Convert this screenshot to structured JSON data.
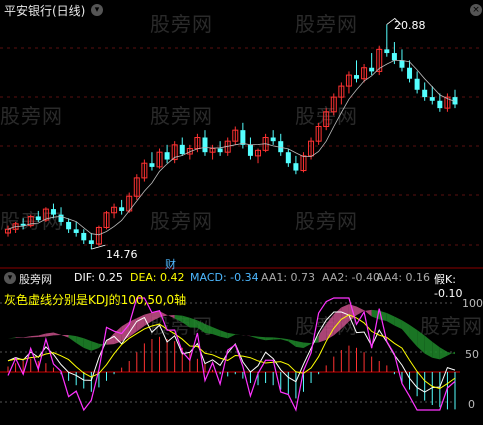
{
  "header": {
    "title": "平安银行(日线)",
    "watermark": "股旁网"
  },
  "price_chart": {
    "high_label": "20.88",
    "low_label": "14.76",
    "event_label": "财",
    "corner_icon": "close-icon"
  },
  "indicator_bar": {
    "name": "股旁网",
    "dif": "DIF: 0.25",
    "dea": "DEA: 0.42",
    "macd": "MACD: -0.34",
    "aa1": "AA1: 0.73",
    "aa2": "AA2: -0.40",
    "aa4": "AA4: 0.16",
    "jk": "假K: -0.10",
    "note": "灰色虚线分别是KDJ的100,50,0轴",
    "axis_ticks": [
      "100",
      "50",
      "0"
    ]
  },
  "colors": {
    "up": "#ff3232",
    "down": "#54ffff",
    "ma": "#ffffff",
    "dif": "#ffffff",
    "dea": "#ffff00",
    "kdj": "#ff33ff",
    "fill_pink": "#c8508a",
    "fill_green": "#1f8a2a"
  },
  "chart_data": [
    {
      "type": "candlestick",
      "title": "平安银行(日线)",
      "annotations": [
        "20.88",
        "14.76"
      ],
      "ohlc": [
        [
          15.2,
          15.4,
          15.1,
          15.3
        ],
        [
          15.3,
          15.5,
          15.2,
          15.45
        ],
        [
          15.45,
          15.6,
          15.3,
          15.4
        ],
        [
          15.4,
          15.7,
          15.35,
          15.65
        ],
        [
          15.65,
          15.8,
          15.5,
          15.55
        ],
        [
          15.55,
          15.9,
          15.5,
          15.85
        ],
        [
          15.85,
          16.0,
          15.6,
          15.7
        ],
        [
          15.7,
          15.9,
          15.4,
          15.5
        ],
        [
          15.5,
          15.6,
          15.2,
          15.3
        ],
        [
          15.3,
          15.5,
          15.1,
          15.2
        ],
        [
          15.2,
          15.3,
          14.9,
          15.0
        ],
        [
          15.0,
          15.2,
          14.76,
          14.9
        ],
        [
          14.9,
          15.4,
          14.85,
          15.35
        ],
        [
          15.35,
          15.8,
          15.3,
          15.75
        ],
        [
          15.75,
          16.0,
          15.6,
          15.9
        ],
        [
          15.9,
          16.1,
          15.7,
          15.8
        ],
        [
          15.8,
          16.3,
          15.75,
          16.2
        ],
        [
          16.2,
          16.8,
          16.1,
          16.7
        ],
        [
          16.7,
          17.2,
          16.6,
          17.1
        ],
        [
          17.1,
          17.4,
          16.9,
          17.0
        ],
        [
          17.0,
          17.5,
          16.95,
          17.4
        ],
        [
          17.4,
          17.6,
          17.1,
          17.2
        ],
        [
          17.2,
          17.7,
          17.1,
          17.6
        ],
        [
          17.6,
          17.8,
          17.3,
          17.35
        ],
        [
          17.35,
          17.6,
          17.2,
          17.5
        ],
        [
          17.5,
          17.9,
          17.4,
          17.8
        ],
        [
          17.8,
          18.0,
          17.3,
          17.4
        ],
        [
          17.4,
          17.6,
          17.2,
          17.5
        ],
        [
          17.5,
          17.7,
          17.3,
          17.4
        ],
        [
          17.4,
          17.8,
          17.3,
          17.7
        ],
        [
          17.7,
          18.1,
          17.6,
          18.0
        ],
        [
          18.0,
          18.2,
          17.5,
          17.6
        ],
        [
          17.6,
          17.8,
          17.2,
          17.3
        ],
        [
          17.3,
          17.5,
          17.1,
          17.45
        ],
        [
          17.45,
          17.9,
          17.4,
          17.8
        ],
        [
          17.8,
          18.0,
          17.6,
          17.7
        ],
        [
          17.7,
          17.9,
          17.3,
          17.4
        ],
        [
          17.4,
          17.5,
          17.0,
          17.1
        ],
        [
          17.1,
          17.3,
          16.8,
          16.9
        ],
        [
          16.9,
          17.4,
          16.85,
          17.3
        ],
        [
          17.3,
          17.8,
          17.2,
          17.7
        ],
        [
          17.7,
          18.2,
          17.6,
          18.1
        ],
        [
          18.1,
          18.6,
          18.0,
          18.5
        ],
        [
          18.5,
          19.0,
          18.4,
          18.9
        ],
        [
          18.9,
          19.3,
          18.7,
          19.2
        ],
        [
          19.2,
          19.6,
          19.0,
          19.5
        ],
        [
          19.5,
          19.9,
          19.3,
          19.4
        ],
        [
          19.4,
          19.8,
          19.3,
          19.7
        ],
        [
          19.7,
          20.1,
          19.5,
          19.6
        ],
        [
          19.6,
          20.3,
          19.5,
          20.2
        ],
        [
          20.2,
          20.88,
          20.0,
          20.1
        ],
        [
          20.1,
          20.4,
          19.8,
          19.9
        ],
        [
          19.9,
          20.2,
          19.6,
          19.7
        ],
        [
          19.7,
          19.9,
          19.3,
          19.4
        ],
        [
          19.4,
          19.6,
          19.0,
          19.1
        ],
        [
          19.1,
          19.3,
          18.8,
          18.9
        ],
        [
          18.9,
          19.2,
          18.7,
          18.8
        ],
        [
          18.8,
          19.0,
          18.5,
          18.6
        ],
        [
          18.6,
          19.0,
          18.5,
          18.9
        ],
        [
          18.9,
          19.1,
          18.6,
          18.7
        ]
      ]
    },
    {
      "type": "bar",
      "title": "MACD",
      "series": [
        {
          "name": "MACD",
          "values": [
            0.05,
            0.08,
            0.1,
            0.12,
            0.1,
            0.08,
            0.04,
            -0.02,
            -0.08,
            -0.12,
            -0.15,
            -0.18,
            -0.14,
            -0.08,
            -0.02,
            0.04,
            0.1,
            0.18,
            0.26,
            0.3,
            0.32,
            0.3,
            0.28,
            0.22,
            0.18,
            0.12,
            0.08,
            0.02,
            -0.02,
            -0.04,
            -0.02,
            -0.06,
            -0.1,
            -0.12,
            -0.1,
            -0.12,
            -0.16,
            -0.2,
            -0.24,
            -0.18,
            -0.1,
            -0.02,
            0.06,
            0.14,
            0.2,
            0.24,
            0.22,
            0.18,
            0.14,
            0.1,
            0.06,
            -0.02,
            -0.1,
            -0.16,
            -0.22,
            -0.26,
            -0.3,
            -0.32,
            -0.34,
            -0.34
          ]
        }
      ]
    }
  ]
}
